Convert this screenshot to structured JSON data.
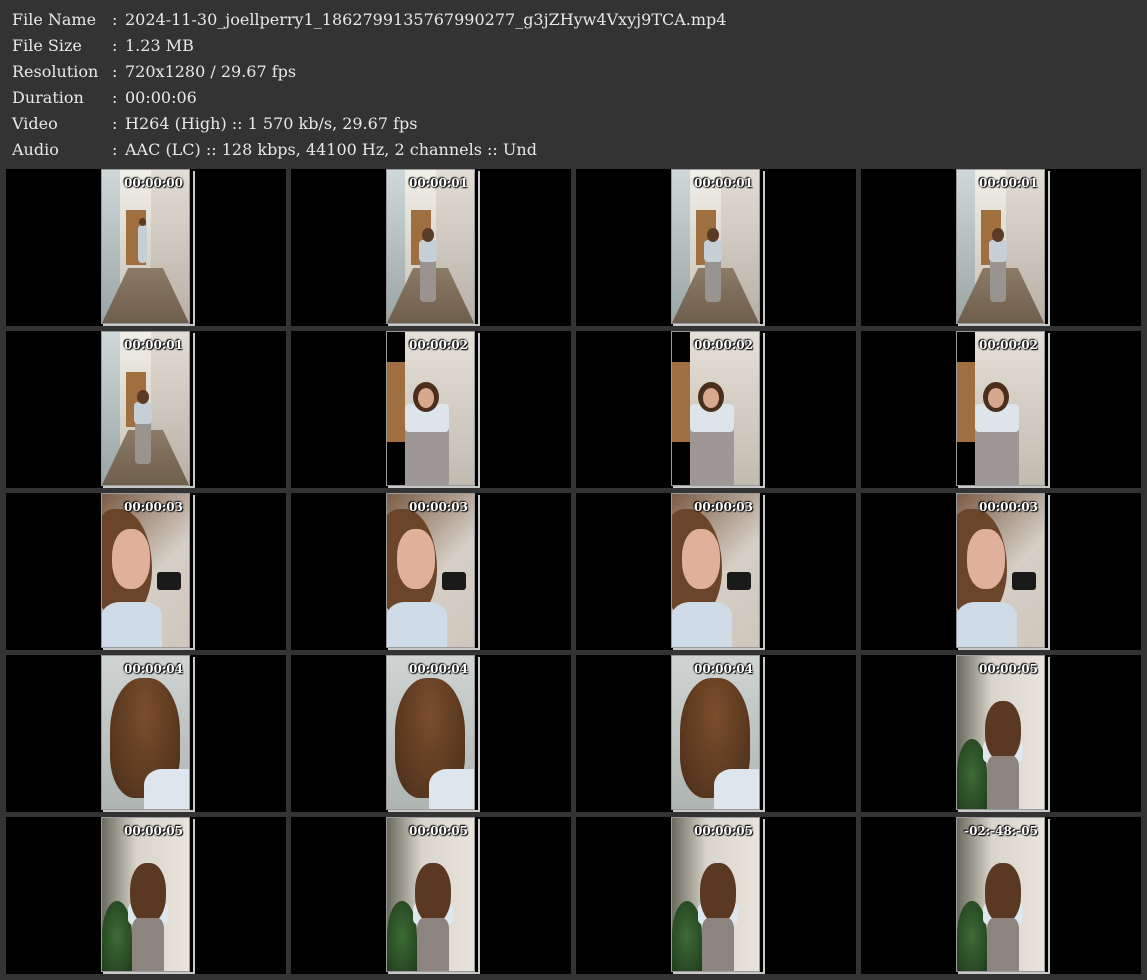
{
  "info": [
    {
      "label": "File Name",
      "sep": ":",
      "value": "2024-11-30_joellperry1_1862799135767990277_g3jZHyw4Vxyj9TCA.mp4"
    },
    {
      "label": "File Size",
      "sep": ":",
      "value": "1.23 MB"
    },
    {
      "label": "Resolution",
      "sep": ":",
      "value": "720x1280 / 29.67 fps"
    },
    {
      "label": "Duration",
      "sep": ":",
      "value": "00:00:06"
    },
    {
      "label": "Video",
      "sep": ":",
      "value": "H264 (High) :: 1 570 kb/s, 29.67 fps"
    },
    {
      "label": "Audio",
      "sep": ":",
      "value": "AAC (LC) :: 128 kbps, 44100 Hz, 2 channels :: Und"
    }
  ],
  "thumbnails": [
    {
      "timestamp": "00:00:00",
      "scene": "hallway-far"
    },
    {
      "timestamp": "00:00:01",
      "scene": "hallway-mid"
    },
    {
      "timestamp": "00:00:01",
      "scene": "hallway-mid"
    },
    {
      "timestamp": "00:00:01",
      "scene": "hallway-mid"
    },
    {
      "timestamp": "00:00:01",
      "scene": "hallway-mid"
    },
    {
      "timestamp": "00:00:02",
      "scene": "hallway-near"
    },
    {
      "timestamp": "00:00:02",
      "scene": "hallway-near"
    },
    {
      "timestamp": "00:00:02",
      "scene": "hallway-near"
    },
    {
      "timestamp": "00:00:03",
      "scene": "face"
    },
    {
      "timestamp": "00:00:03",
      "scene": "face"
    },
    {
      "timestamp": "00:00:03",
      "scene": "face"
    },
    {
      "timestamp": "00:00:03",
      "scene": "face"
    },
    {
      "timestamp": "00:00:04",
      "scene": "back-hair"
    },
    {
      "timestamp": "00:00:04",
      "scene": "back-hair"
    },
    {
      "timestamp": "00:00:04",
      "scene": "back-hair"
    },
    {
      "timestamp": "00:00:05",
      "scene": "walk"
    },
    {
      "timestamp": "00:00:05",
      "scene": "walk"
    },
    {
      "timestamp": "00:00:05",
      "scene": "walk"
    },
    {
      "timestamp": "00:00:05",
      "scene": "walk"
    },
    {
      "timestamp": "-02:-48:-05",
      "scene": "walk"
    }
  ]
}
